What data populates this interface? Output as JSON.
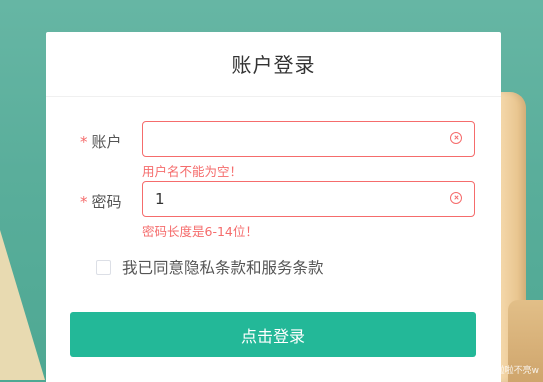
{
  "title": "账户登录",
  "form": {
    "required_mark": "*",
    "account": {
      "label": "账户",
      "value": "",
      "error": "用户名不能为空！"
    },
    "password": {
      "label": "密码",
      "value": "1",
      "error": "密码长度是6-14位！"
    },
    "agreement": {
      "checked": false,
      "text": "我已同意隐私条款和服务条款"
    },
    "submit_label": "点击登录"
  },
  "watermark": "CSDN @巴啦啦不亮w",
  "colors": {
    "accent": "#23b898",
    "error": "#f56c6c",
    "background": "#5aae9b"
  },
  "icons": {
    "clear": "circle-close-icon"
  }
}
